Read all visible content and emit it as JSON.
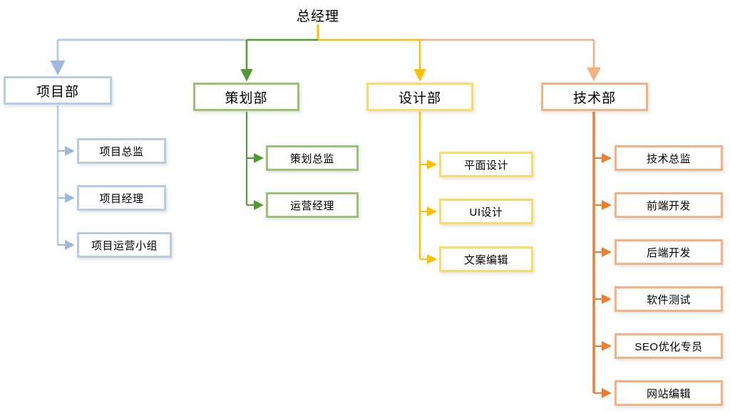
{
  "diagram": {
    "type": "organizational-chart",
    "title": "",
    "background_color": "#ffffff",
    "root": {
      "label": "总经理",
      "color": "#000000"
    },
    "branch_colors": {
      "project": "#b8cce4",
      "planning": "#4f9b31",
      "design": "#ffc000",
      "technology": "#ed7d31",
      "technology_light": "#f4b183"
    },
    "departments": [
      {
        "id": "project",
        "label": "项目部",
        "border_color": "#b8cce4",
        "line_color": "#b8cce4",
        "children": [
          {
            "label": "项目总监"
          },
          {
            "label": "项目经理"
          },
          {
            "label": "项目运营小组"
          }
        ]
      },
      {
        "id": "planning",
        "label": "策划部",
        "border_color": "#9bc175",
        "line_color": "#4f9b31",
        "children": [
          {
            "label": "策划总监"
          },
          {
            "label": "运营经理"
          }
        ]
      },
      {
        "id": "design",
        "label": "设计部",
        "border_color": "#ffd966",
        "line_color": "#ffc000",
        "children": [
          {
            "label": "平面设计"
          },
          {
            "label": "UI设计"
          },
          {
            "label": "文案编辑"
          }
        ]
      },
      {
        "id": "technology",
        "label": "技术部",
        "border_color": "#f4b183",
        "line_color": "#ed7d31",
        "children": [
          {
            "label": "技术总监"
          },
          {
            "label": "前端开发"
          },
          {
            "label": "后端开发"
          },
          {
            "label": "软件测试"
          },
          {
            "label": "SEO优化专员"
          },
          {
            "label": "网站编辑"
          }
        ]
      }
    ]
  }
}
